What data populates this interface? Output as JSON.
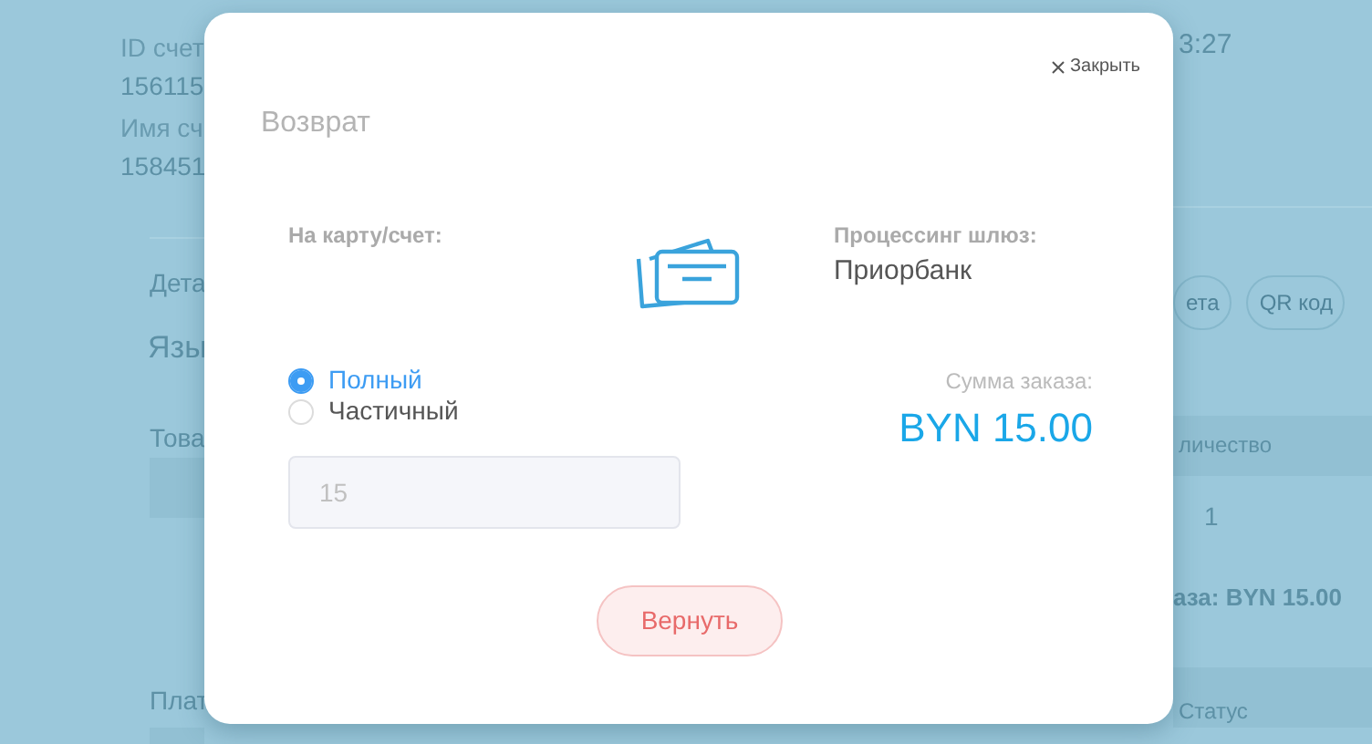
{
  "background_page": {
    "left_fields": [
      {
        "label": "ID счет",
        "value": "156115"
      },
      {
        "label": "Имя сч",
        "value": "158451"
      }
    ],
    "left_section": "Дета",
    "left_language": "Язы",
    "left_goods": "Това",
    "left_payments": "Плат",
    "right_time": "3:27",
    "right_buttons": [
      "ета",
      "QR код"
    ],
    "right_table_header": "личество",
    "right_table_cell": "1",
    "right_total": "аза: BYN 15.00",
    "right_status_header": "Статус"
  },
  "modal": {
    "close_label": "Закрыть",
    "title": "Возврат",
    "destination_label": "На карту/счет:",
    "gateway_label": "Процессинг шлюз:",
    "gateway_value": "Приорбанк",
    "refund_types": [
      {
        "label": "Полный",
        "selected": true
      },
      {
        "label": "Частичный",
        "selected": false
      }
    ],
    "amount_field": {
      "value": "15",
      "disabled": true
    },
    "total_label": "Сумма заказа:",
    "total_value": "BYN 15.00",
    "submit_button": "Вернуть"
  }
}
